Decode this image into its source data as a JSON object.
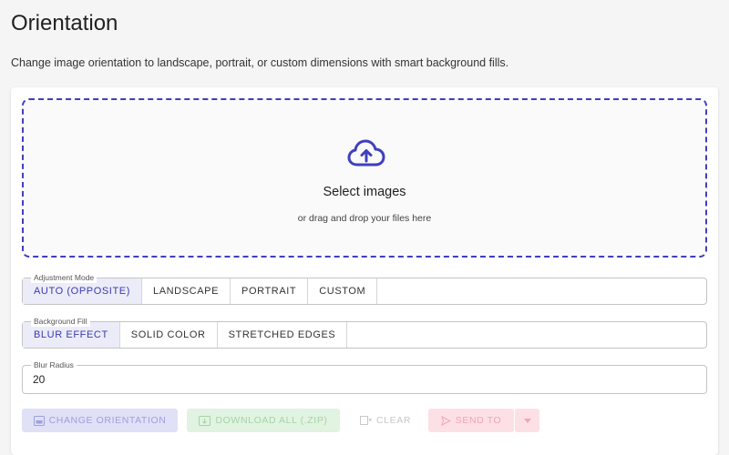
{
  "page": {
    "title": "Orientation",
    "description": "Change image orientation to landscape, portrait, or custom dimensions with smart background fills."
  },
  "dropzone": {
    "icon": "cloud-upload-icon",
    "title": "Select images",
    "subtitle": "or drag and drop your files here"
  },
  "adjustment_mode": {
    "legend": "Adjustment Mode",
    "options": [
      "AUTO (OPPOSITE)",
      "LANDSCAPE",
      "PORTRAIT",
      "CUSTOM"
    ],
    "selected": "AUTO (OPPOSITE)"
  },
  "background_fill": {
    "legend": "Background Fill",
    "options": [
      "BLUR EFFECT",
      "SOLID COLOR",
      "STRETCHED EDGES"
    ],
    "selected": "BLUR EFFECT"
  },
  "blur_radius": {
    "legend": "Blur Radius",
    "value": "20"
  },
  "actions": {
    "change_label": "CHANGE ORIENTATION",
    "download_label": "DOWNLOAD ALL (.ZIP)",
    "clear_label": "CLEAR",
    "send_label": "SEND TO"
  },
  "colors": {
    "accent": "#3f3fbf",
    "background": "#f5f5f5"
  }
}
